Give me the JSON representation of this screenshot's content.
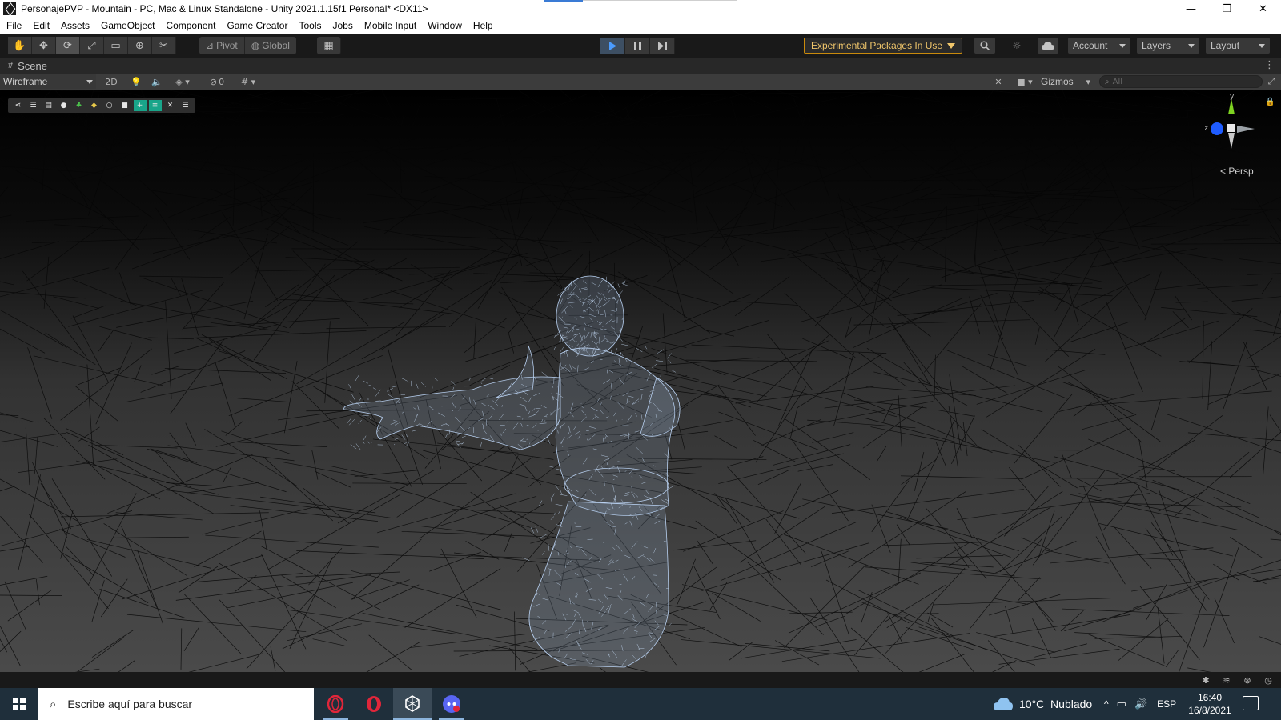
{
  "window": {
    "title": "PersonajePVP - Mountain - PC, Mac & Linux Standalone - Unity 2021.1.15f1 Personal* <DX11>",
    "minimize_glyph": "—",
    "restore_glyph": "❐",
    "close_glyph": "✕"
  },
  "menu": {
    "items": [
      "File",
      "Edit",
      "Assets",
      "GameObject",
      "Component",
      "Game Creator",
      "Tools",
      "Jobs",
      "Mobile Input",
      "Window",
      "Help"
    ]
  },
  "toolbar": {
    "tools": [
      {
        "name": "hand-tool",
        "glyph": "✋"
      },
      {
        "name": "move-tool",
        "glyph": "✥"
      },
      {
        "name": "rotate-tool",
        "glyph": "⟳"
      },
      {
        "name": "scale-tool",
        "glyph": "⤢"
      },
      {
        "name": "rect-tool",
        "glyph": "▭"
      },
      {
        "name": "transform-tool",
        "glyph": "⊕"
      },
      {
        "name": "custom-tool",
        "glyph": "✂"
      }
    ],
    "pivot_label": "Pivot",
    "global_label": "Global",
    "grid_snap_glyph": "▦",
    "experimental_label": "Experimental Packages In Use",
    "account_label": "Account",
    "layers_label": "Layers",
    "layout_label": "Layout"
  },
  "scene": {
    "tab_label": "Scene",
    "draw_mode": "Wireframe",
    "mode_2d": "2D",
    "hidden_count": "0",
    "gizmos_label": "Gizmos",
    "search_placeholder": "All",
    "persp_label": "< Persp",
    "gizmo_y": "y",
    "gizmo_z": "z"
  },
  "taskbar": {
    "search_placeholder": "Escribe aquí para buscar",
    "weather": "10°C  Nublado",
    "language": "ESP",
    "time": "16:40",
    "date": "16/8/2021"
  },
  "colors": {
    "accent_play": "#4b9cff",
    "experimental_border": "#c98a0c",
    "wireframe_character": "#b8d0f0",
    "taskbar_bg": "#1f2f3b"
  }
}
